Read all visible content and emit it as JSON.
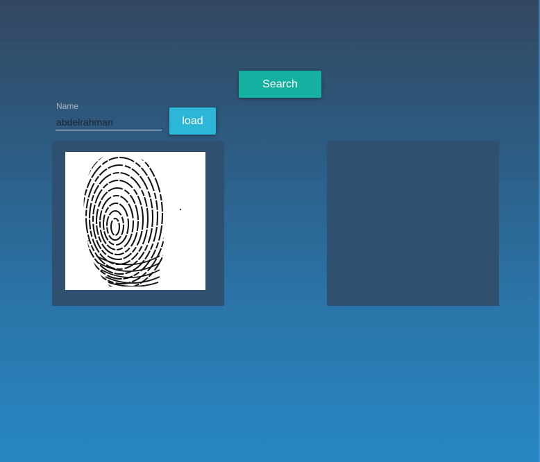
{
  "toolbar": {
    "search_label": "Search",
    "load_label": "load"
  },
  "name_field": {
    "label": "Name",
    "value": "abdelrahman"
  },
  "panels": {
    "left": {
      "image_icon": "fingerprint-image"
    },
    "right": {
      "image_icon": "empty-image-slot"
    }
  },
  "colors": {
    "search_button": "#14b0a0",
    "load_button": "#2cb6d8",
    "panel": "#30506f"
  }
}
